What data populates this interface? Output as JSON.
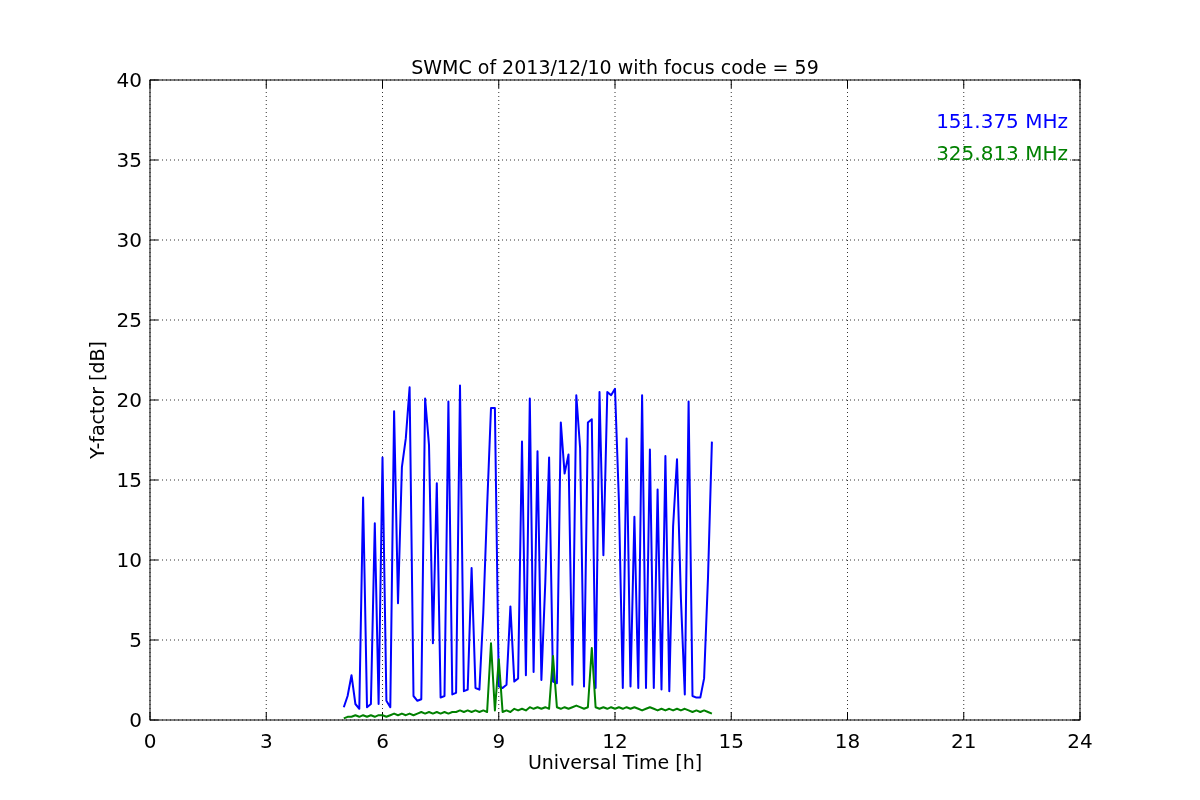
{
  "chart_data": {
    "type": "line",
    "title": "SWMC of 2013/12/10 with focus code = 59",
    "xlabel": "Universal Time [h]",
    "ylabel": "Y-factor [dB]",
    "x": [
      5.0,
      5.1,
      5.2,
      5.3,
      5.4,
      5.5,
      5.6,
      5.7,
      5.8,
      5.9,
      6.0,
      6.1,
      6.2,
      6.3,
      6.4,
      6.5,
      6.6,
      6.7,
      6.8,
      6.9,
      7.0,
      7.1,
      7.2,
      7.3,
      7.4,
      7.5,
      7.6,
      7.7,
      7.8,
      7.9,
      8.0,
      8.1,
      8.2,
      8.3,
      8.4,
      8.5,
      8.6,
      8.7,
      8.8,
      8.9,
      9.0,
      9.1,
      9.2,
      9.3,
      9.4,
      9.5,
      9.6,
      9.7,
      9.8,
      9.9,
      10.0,
      10.1,
      10.2,
      10.3,
      10.4,
      10.5,
      10.6,
      10.7,
      10.8,
      10.9,
      11.0,
      11.1,
      11.2,
      11.3,
      11.4,
      11.5,
      11.6,
      11.7,
      11.8,
      11.9,
      12.0,
      12.1,
      12.2,
      12.3,
      12.4,
      12.5,
      12.6,
      12.7,
      12.8,
      12.9,
      13.0,
      13.1,
      13.2,
      13.3,
      13.4,
      13.5,
      13.6,
      13.7,
      13.8,
      13.9,
      14.0,
      14.1,
      14.2,
      14.3,
      14.4,
      14.5
    ],
    "series": [
      {
        "name": "151.375 MHz",
        "color": "#0000ff",
        "values": [
          0.8,
          1.5,
          2.8,
          1.0,
          0.7,
          13.9,
          0.8,
          1.0,
          12.3,
          1.0,
          16.4,
          1.2,
          0.8,
          19.3,
          7.3,
          15.8,
          17.6,
          20.8,
          1.5,
          1.2,
          1.3,
          20.1,
          17.2,
          4.8,
          14.8,
          1.4,
          1.5,
          19.9,
          1.6,
          1.7,
          20.9,
          1.8,
          1.9,
          9.5,
          2.0,
          1.9,
          6.7,
          13.3,
          19.5,
          19.5,
          2.1,
          2.0,
          2.2,
          7.1,
          2.4,
          2.6,
          17.4,
          2.8,
          20.1,
          3.0,
          16.8,
          2.5,
          8.6,
          16.4,
          2.4,
          2.3,
          18.6,
          15.4,
          16.6,
          2.2,
          20.3,
          17.0,
          2.1,
          18.6,
          18.8,
          2.0,
          20.5,
          10.3,
          20.5,
          20.3,
          20.7,
          13.7,
          2.0,
          17.6,
          2.1,
          12.7,
          2.0,
          20.3,
          2.0,
          16.9,
          2.0,
          14.4,
          1.9,
          16.5,
          1.8,
          12.1,
          16.3,
          7.6,
          1.6,
          19.9,
          1.5,
          1.4,
          1.4,
          2.6,
          8.9,
          17.4
        ]
      },
      {
        "name": "325.813 MHz",
        "color": "#008000",
        "values": [
          0.1,
          0.2,
          0.2,
          0.3,
          0.2,
          0.3,
          0.2,
          0.3,
          0.2,
          0.3,
          0.3,
          0.2,
          0.3,
          0.4,
          0.3,
          0.4,
          0.3,
          0.4,
          0.3,
          0.4,
          0.5,
          0.4,
          0.5,
          0.4,
          0.5,
          0.4,
          0.5,
          0.4,
          0.5,
          0.5,
          0.6,
          0.5,
          0.6,
          0.5,
          0.6,
          0.5,
          0.6,
          0.5,
          4.8,
          0.6,
          3.8,
          0.5,
          0.6,
          0.5,
          0.7,
          0.6,
          0.7,
          0.6,
          0.8,
          0.7,
          0.8,
          0.7,
          0.8,
          0.7,
          4.0,
          0.8,
          0.7,
          0.8,
          0.7,
          0.8,
          0.9,
          0.8,
          0.7,
          0.8,
          4.5,
          0.8,
          0.7,
          0.8,
          0.7,
          0.8,
          0.7,
          0.8,
          0.7,
          0.8,
          0.7,
          0.8,
          0.7,
          0.6,
          0.7,
          0.8,
          0.7,
          0.6,
          0.7,
          0.6,
          0.7,
          0.6,
          0.7,
          0.6,
          0.7,
          0.6,
          0.5,
          0.6,
          0.5,
          0.6,
          0.5,
          0.4
        ]
      }
    ],
    "grid": true,
    "xlim": [
      0,
      24
    ],
    "ylim": [
      0,
      40
    ],
    "xticks": [
      0,
      3,
      6,
      9,
      12,
      15,
      18,
      21,
      24
    ],
    "yticks": [
      0,
      5,
      10,
      15,
      20,
      25,
      30,
      35,
      40
    ]
  }
}
